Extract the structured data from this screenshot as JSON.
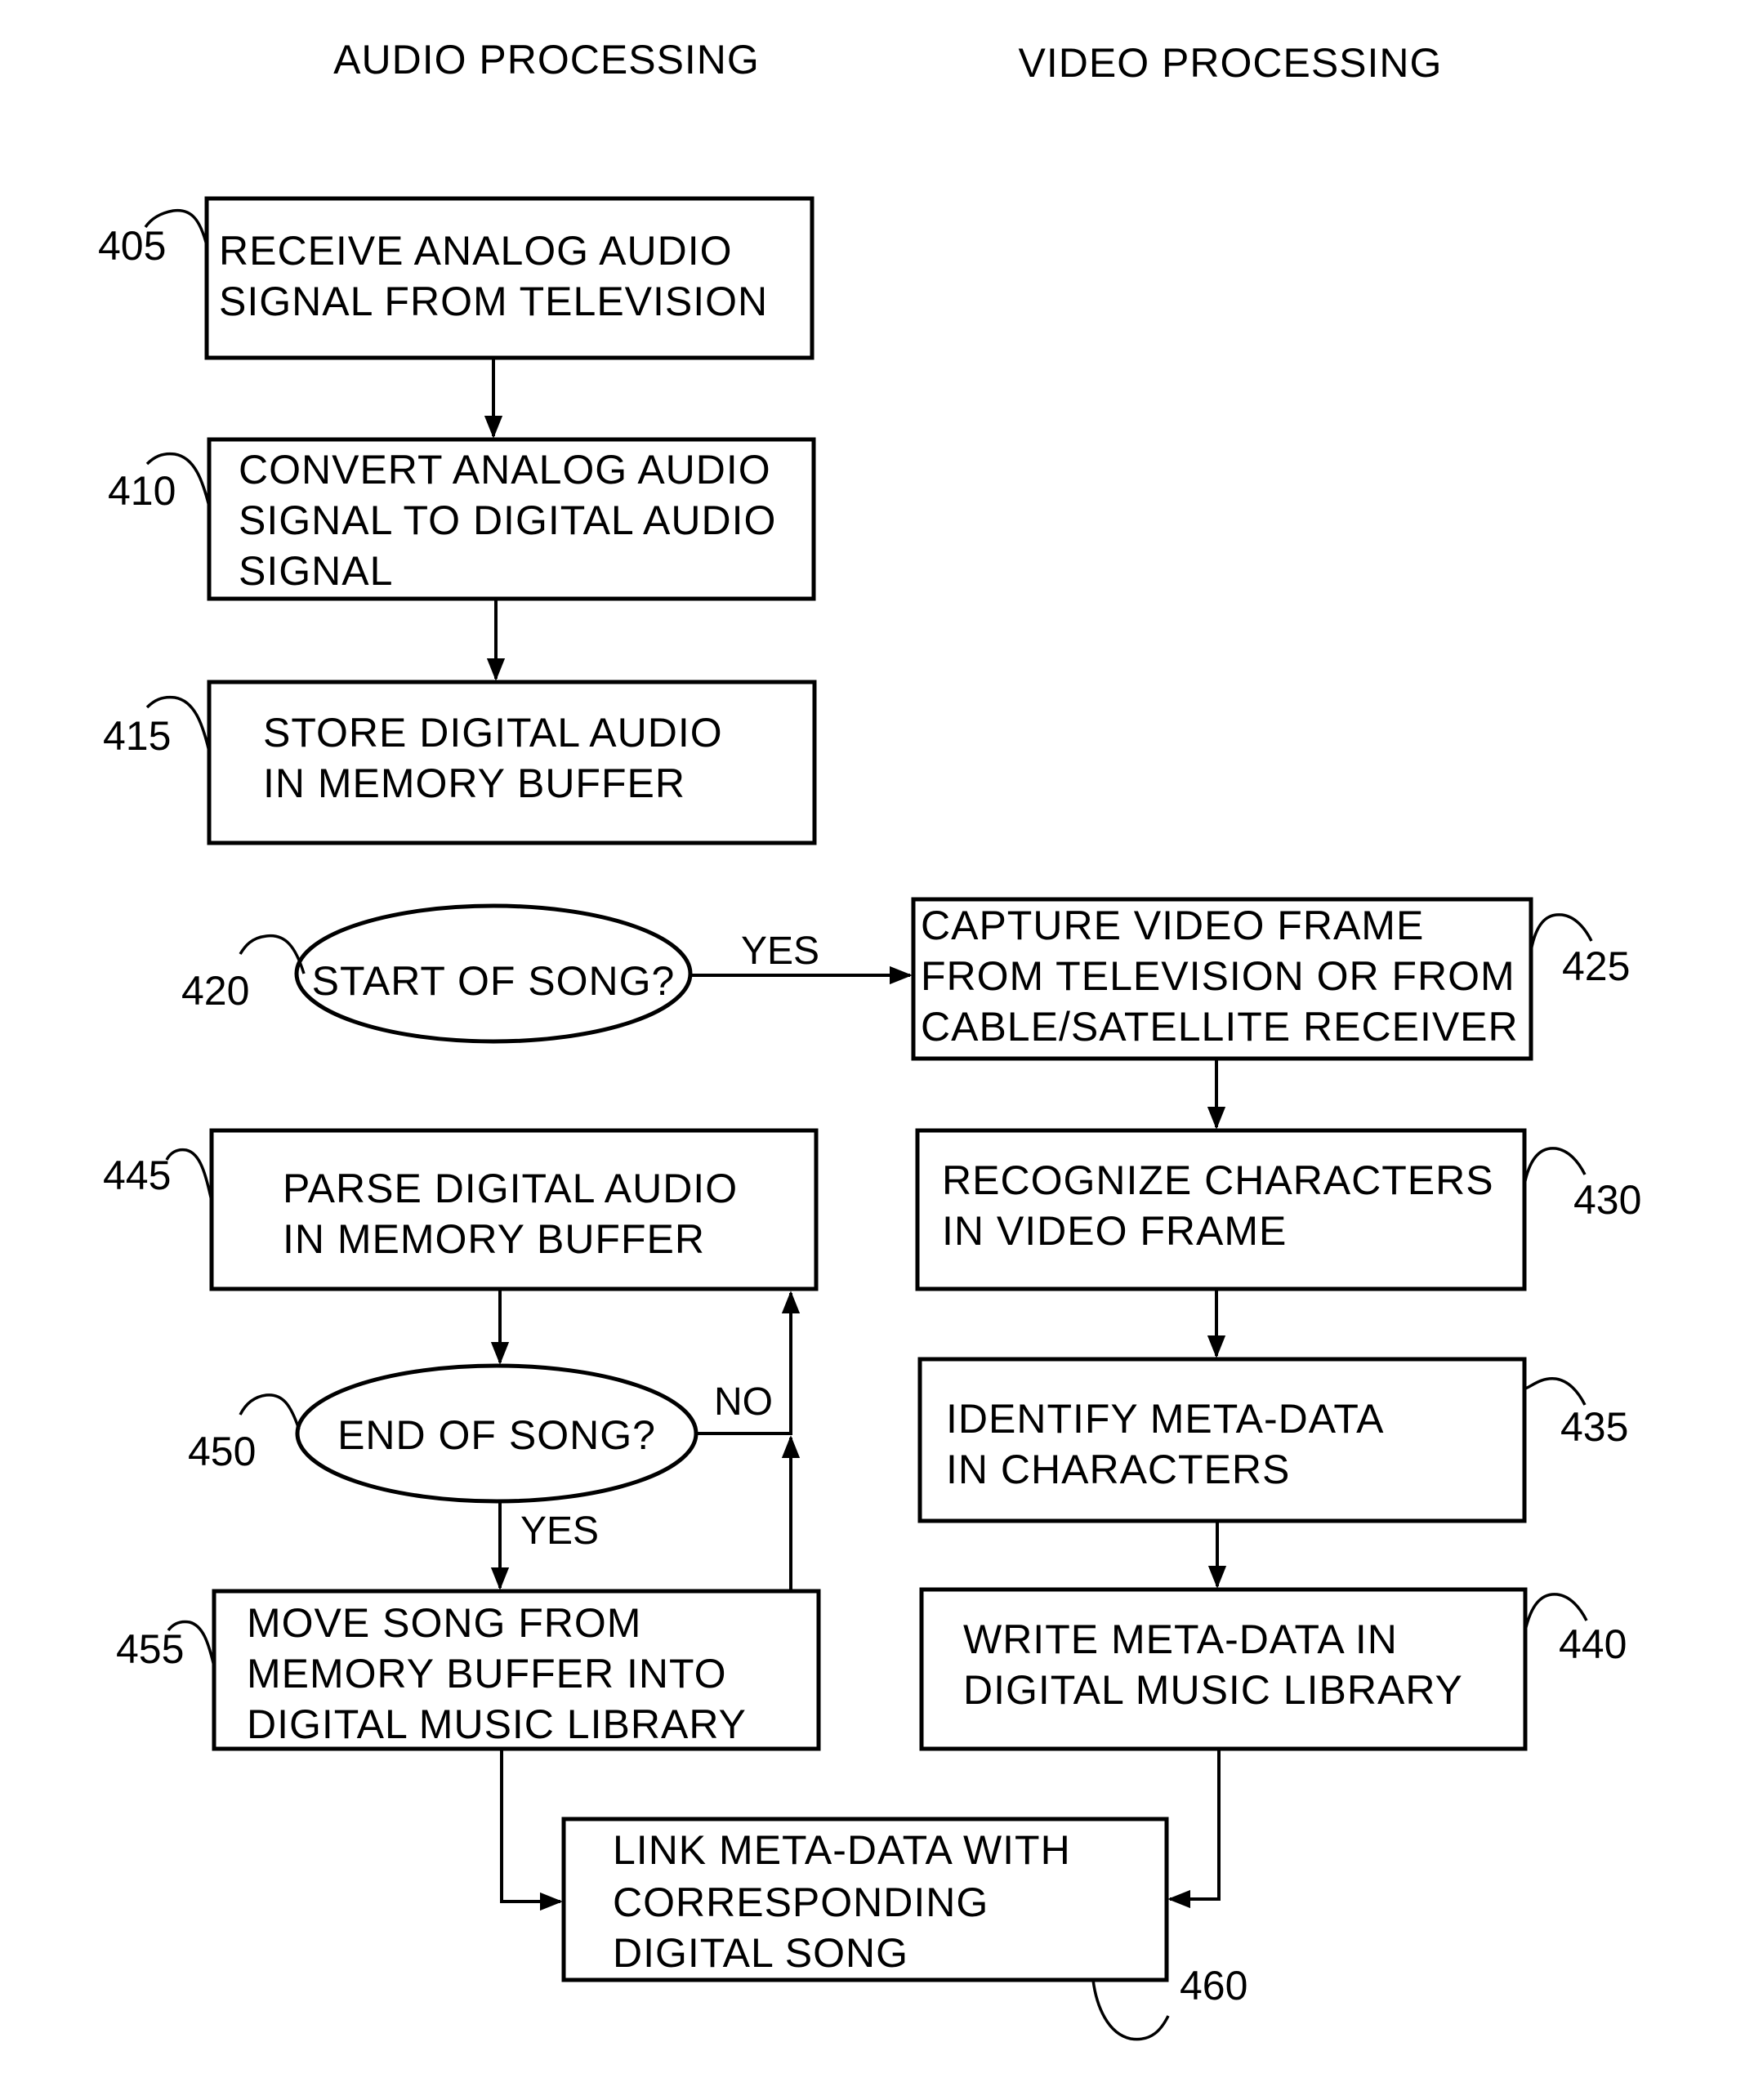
{
  "headers": {
    "audio": "AUDIO PROCESSING",
    "video": "VIDEO PROCESSING"
  },
  "steps": {
    "s405": {
      "ref": "405",
      "lines": [
        "RECEIVE ANALOG AUDIO",
        "SIGNAL FROM TELEVISION"
      ]
    },
    "s410": {
      "ref": "410",
      "lines": [
        "CONVERT ANALOG AUDIO",
        "SIGNAL TO DIGITAL AUDIO",
        "SIGNAL"
      ]
    },
    "s415": {
      "ref": "415",
      "lines": [
        "STORE DIGITAL AUDIO",
        "IN MEMORY BUFFER"
      ]
    },
    "s420": {
      "ref": "420",
      "lines": [
        "START OF SONG?"
      ]
    },
    "s425": {
      "ref": "425",
      "lines": [
        "CAPTURE VIDEO FRAME",
        "FROM TELEVISION OR FROM",
        "CABLE/SATELLITE RECEIVER"
      ]
    },
    "s430": {
      "ref": "430",
      "lines": [
        "RECOGNIZE CHARACTERS",
        "IN VIDEO FRAME"
      ]
    },
    "s435": {
      "ref": "435",
      "lines": [
        "IDENTIFY META-DATA",
        "IN CHARACTERS"
      ]
    },
    "s440": {
      "ref": "440",
      "lines": [
        "WRITE META-DATA IN",
        "DIGITAL MUSIC LIBRARY"
      ]
    },
    "s445": {
      "ref": "445",
      "lines": [
        "PARSE DIGITAL AUDIO",
        "IN MEMORY BUFFER"
      ]
    },
    "s450": {
      "ref": "450",
      "lines": [
        "END OF SONG?"
      ]
    },
    "s455": {
      "ref": "455",
      "lines": [
        "MOVE SONG FROM",
        "MEMORY BUFFER INTO",
        "DIGITAL MUSIC LIBRARY"
      ]
    },
    "s460": {
      "ref": "460",
      "lines": [
        "LINK META-DATA WITH",
        "CORRESPONDING",
        "DIGITAL SONG"
      ]
    }
  },
  "edge_labels": {
    "start_yes": "YES",
    "end_no": "NO",
    "end_yes": "YES"
  }
}
